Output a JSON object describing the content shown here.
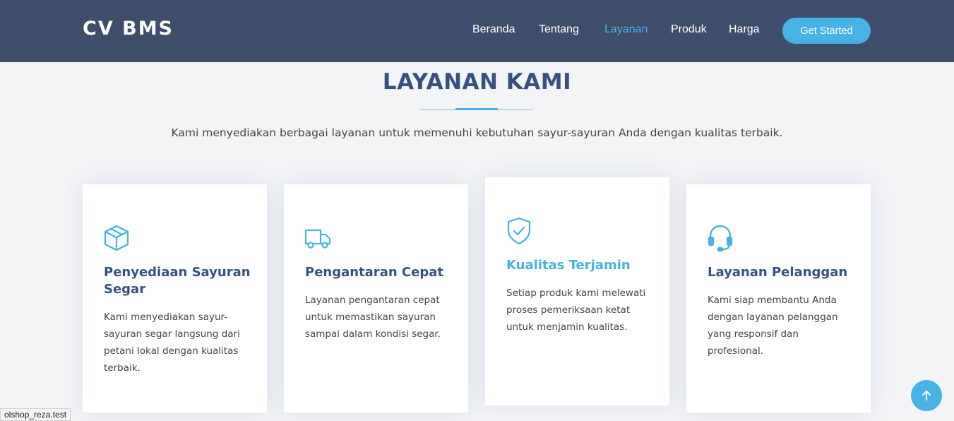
{
  "header": {
    "logo": "CV BMS",
    "nav": [
      {
        "label": "Beranda",
        "active": false
      },
      {
        "label": "Tentang",
        "active": false
      },
      {
        "label": "Layanan",
        "active": true
      },
      {
        "label": "Produk",
        "active": false
      },
      {
        "label": "Harga",
        "active": false
      }
    ],
    "cta_label": "Get Started"
  },
  "services": {
    "title": "LAYANAN KAMI",
    "subtitle": "Kami menyediakan berbagai layanan untuk memenuhi kebutuhan sayur-sayuran Anda dengan kualitas terbaik.",
    "cards": [
      {
        "icon": "box-icon",
        "title": "Penyediaan Sayuran Segar",
        "desc": "Kami menyediakan sayur-sayuran segar langsung dari petani lokal dengan kualitas terbaik."
      },
      {
        "icon": "truck-icon",
        "title": "Pengantaran Cepat",
        "desc": "Layanan pengantaran cepat untuk memastikan sayuran sampai dalam kondisi segar."
      },
      {
        "icon": "shield-check-icon",
        "title": "Kualitas Terjamin",
        "desc": "Setiap produk kami melewati proses pemeriksaan ketat untuk menjamin kualitas."
      },
      {
        "icon": "headset-icon",
        "title": "Layanan Pelanggan",
        "desc": "Kami siap membantu Anda dengan layanan pelanggan yang responsif dan profesional."
      }
    ]
  },
  "status_bar": {
    "url": "olshop_reza.test"
  },
  "back_to_top": {
    "icon": "arrow-up-icon"
  },
  "colors": {
    "header_bg": "#3d4d6a",
    "accent": "#47b2e4",
    "heading": "#37517e",
    "page_bg": "#f2f4f6"
  }
}
